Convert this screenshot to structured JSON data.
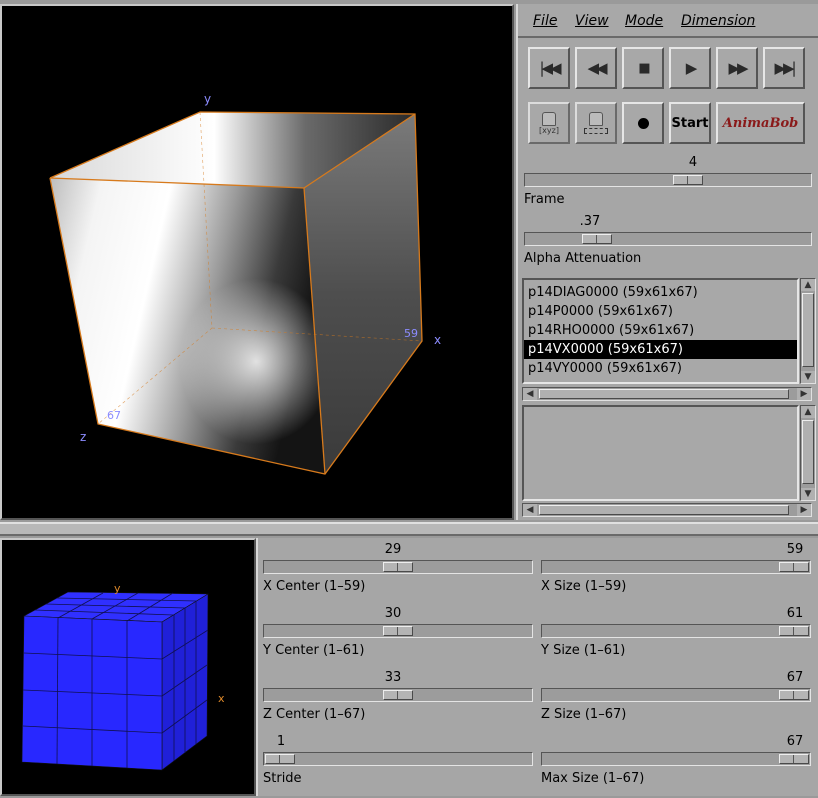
{
  "viewer": {
    "axis_x": "x",
    "axis_y": "y",
    "axis_z": "z",
    "label_x_max": "59",
    "label_z_max": "67"
  },
  "menu": {
    "file": "File",
    "view": "View",
    "mode": "Mode",
    "dimension": "Dimension"
  },
  "transport": {
    "buttons": [
      "first-frame",
      "rewind",
      "stop",
      "play",
      "fast-forward",
      "last-frame"
    ]
  },
  "tools": {
    "xyz_label": "[xyz]",
    "record_icon": "record-icon",
    "start_label": "Start",
    "animabob_label": "AnimaBob",
    "accent_color": "#8a1a1a"
  },
  "frame": {
    "value": "4",
    "label": "Frame",
    "fraction": 0.58
  },
  "alpha": {
    "value": ".37",
    "label": "Alpha Attenuation",
    "fraction": 0.22
  },
  "datasets": [
    "p14DIAG0000 (59x61x67)",
    "p14P0000 (59x61x67)",
    "p14RHO0000 (59x61x67)",
    "p14VX0000 (59x61x67)",
    "p14VY0000 (59x61x67)"
  ],
  "selected_dataset": 3,
  "mini": {
    "axis_x": "x",
    "axis_y": "y",
    "cube_color": "#2828ff"
  },
  "sliders": [
    {
      "value": "29",
      "label": "X Center (1–59)",
      "fraction": 0.5
    },
    {
      "value": "59",
      "label": "X Size (1–59)",
      "fraction": 1.0
    },
    {
      "value": "30",
      "label": "Y Center (1–61)",
      "fraction": 0.5
    },
    {
      "value": "61",
      "label": "Y Size (1–61)",
      "fraction": 1.0
    },
    {
      "value": "33",
      "label": "Z Center (1–67)",
      "fraction": 0.5
    },
    {
      "value": "67",
      "label": "Z Size (1–67)",
      "fraction": 1.0
    },
    {
      "value": "1",
      "label": "Stride",
      "fraction": 0.0
    },
    {
      "value": "67",
      "label": "Max Size (1–67)",
      "fraction": 1.0
    }
  ]
}
